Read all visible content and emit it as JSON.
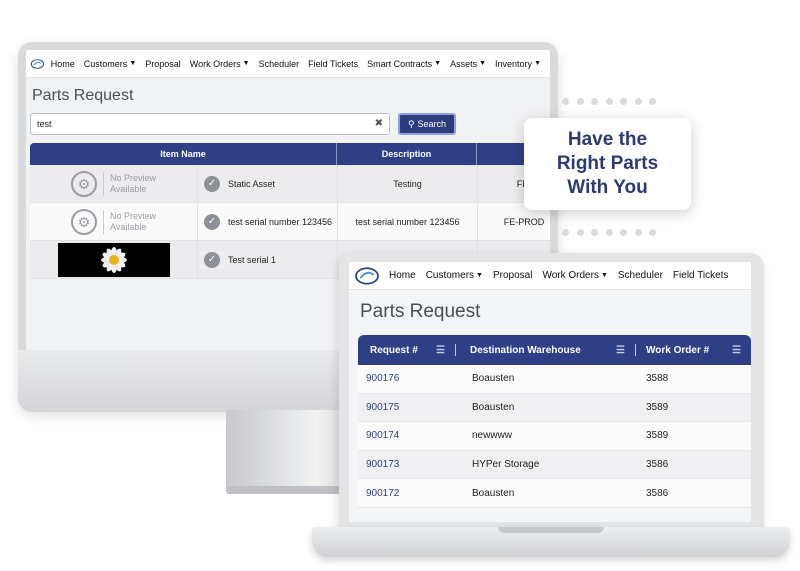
{
  "nav": {
    "home": "Home",
    "customers": "Customers",
    "proposal": "Proposal",
    "work_orders": "Work Orders",
    "scheduler": "Scheduler",
    "field_tickets": "Field Tickets",
    "smart_contracts": "Smart Contracts",
    "assets": "Assets",
    "inventory": "Inventory"
  },
  "desktop": {
    "title": "Parts Request",
    "search_value": "test",
    "search_button": "Search",
    "columns": [
      "Item Name",
      "Description"
    ],
    "no_preview_line1": "No Preview",
    "no_preview_line2": "Available",
    "rows": [
      {
        "name": "Static Asset",
        "description": "Testing",
        "code": "FE-"
      },
      {
        "name": "test serial number 123456",
        "description": "test serial number 123456",
        "code": "FE-PROD"
      },
      {
        "name": "Test serial 1",
        "description": "",
        "code": ""
      }
    ]
  },
  "callout": {
    "line1": "Have the",
    "line2": "Right Parts",
    "line3": "With You"
  },
  "laptop": {
    "title": "Parts Request",
    "columns": [
      "Request #",
      "Destination Warehouse",
      "Work Order #"
    ],
    "rows": [
      {
        "request": "900176",
        "warehouse": "Boausten",
        "work_order": "3588"
      },
      {
        "request": "900175",
        "warehouse": "Boausten",
        "work_order": "3589"
      },
      {
        "request": "900174",
        "warehouse": "newwww",
        "work_order": "3589"
      },
      {
        "request": "900173",
        "warehouse": "HYPer Storage",
        "work_order": "3586"
      },
      {
        "request": "900172",
        "warehouse": "Boausten",
        "work_order": "3586"
      }
    ]
  }
}
